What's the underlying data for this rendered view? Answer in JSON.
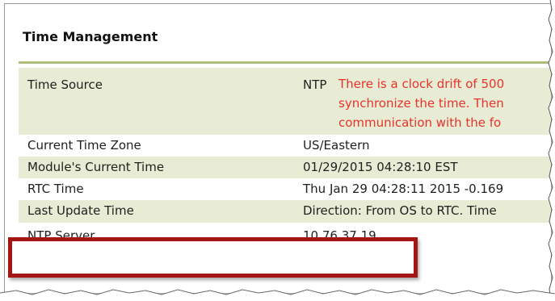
{
  "panel": {
    "title": "Time Management",
    "accent_color": "#aebf78",
    "alt_row_color": "#e8ecd4",
    "warning_color": "#e8332b",
    "highlight_color": "#a31513"
  },
  "rows": [
    {
      "label": "Time Source",
      "value": "NTP",
      "warning_lines": [
        "There is a clock drift of 500",
        "synchronize the time. Then",
        "communication with the fo"
      ]
    },
    {
      "label": "Current Time Zone",
      "value": "US/Eastern"
    },
    {
      "label": "Module's Current Time",
      "value": "01/29/2015 04:28:10 EST"
    },
    {
      "label": "RTC Time",
      "value": "Thu Jan 29 04:28:11 2015 -0.169"
    },
    {
      "label": "Last Update Time",
      "value": "Direction: From OS to RTC. Time"
    },
    {
      "label": "NTP Server",
      "value": "10.76.37.19"
    }
  ]
}
